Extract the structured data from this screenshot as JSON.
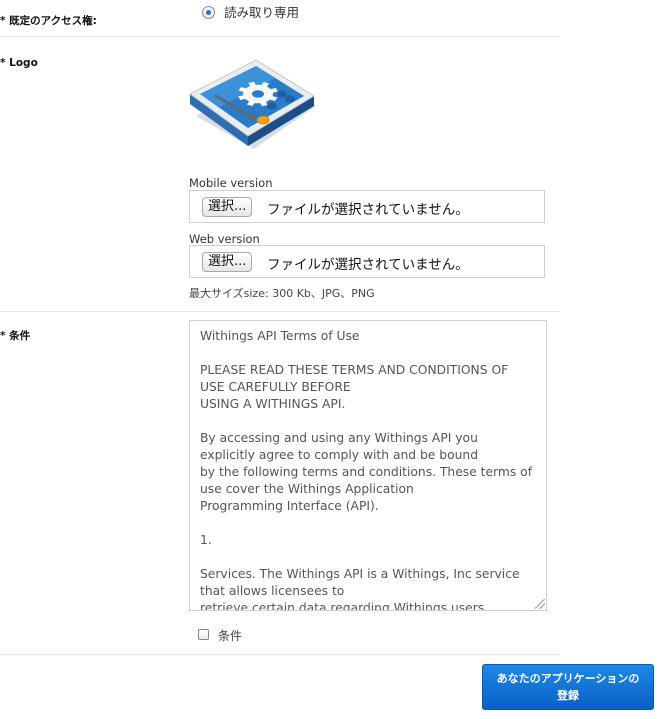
{
  "access": {
    "label": "* 既定のアクセス権:",
    "option_label": "読み取り専用"
  },
  "logo": {
    "label": "* Logo",
    "mobile_label": "Mobile version",
    "web_label": "Web version",
    "choose_button": "選択...",
    "no_file_text": "ファイルが選択されていません。",
    "max_size_note": "最大サイズsize: 300 Kb、JPG、PNG"
  },
  "terms": {
    "label": "* 条件",
    "paragraphs": [
      "Withings API Terms of Use",
      "PLEASE READ THESE TERMS AND CONDITIONS OF USE CAREFULLY BEFORE\nUSING A WITHINGS API.",
      "By accessing and using any Withings API you explicitly agree to comply with and be bound\nby the following terms and conditions. These terms of use cover the Withings Application\nProgramming Interface (API).",
      "1.",
      "Services. The Withings API is a Withings, Inc service that allows licensees to\nretrieve certain data regarding Withings users. Withings"
    ],
    "checkbox_label": "条件"
  },
  "submit": {
    "line1": "あなたのアプリケーションの",
    "line2": "登録"
  },
  "colors": {
    "accent": "#0b5fc6",
    "radio_dot": "#2d6fd6",
    "separator": "#e6e6e6"
  }
}
